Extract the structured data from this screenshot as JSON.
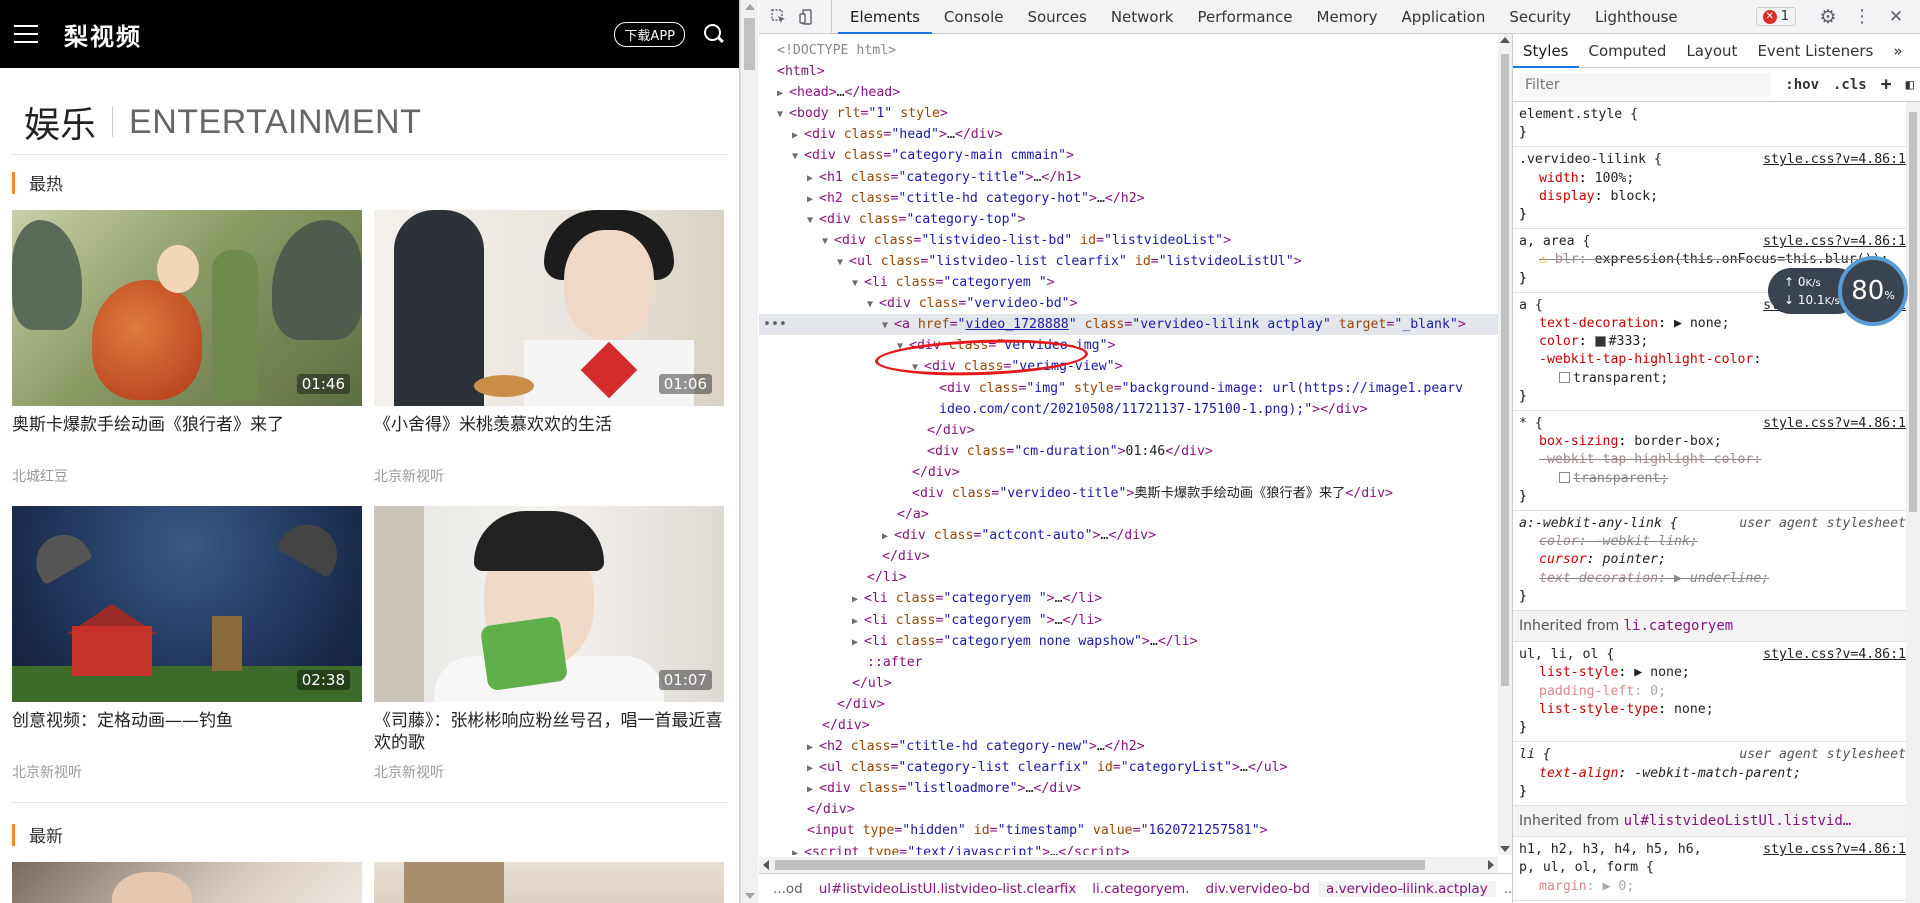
{
  "mobile": {
    "logo": "梨视频",
    "download_button": "下载APP",
    "category_cn": "娱乐",
    "category_en": "ENTERTAINMENT",
    "section_hot": "最热",
    "section_new": "最新",
    "videos": [
      {
        "title": "奥斯卡爆款手绘动画《狼行者》来了",
        "author": "北城红豆",
        "duration": "01:46"
      },
      {
        "title": "《小舍得》米桃羡慕欢欢的生活",
        "author": "北京新视听",
        "duration": "01:06"
      },
      {
        "title": "创意视频：定格动画——钓鱼",
        "author": "北京新视听",
        "duration": "02:38"
      },
      {
        "title": "《司藤》：张彬彬响应粉丝号召，唱一首最近喜欢的歌",
        "author": "北京新视听",
        "duration": "01:07"
      }
    ]
  },
  "devtools": {
    "tabs": [
      "Elements",
      "Console",
      "Sources",
      "Network",
      "Performance",
      "Memory",
      "Application",
      "Security",
      "Lighthouse"
    ],
    "active_tab": "Elements",
    "error_count": "1",
    "styles_tabs": [
      "Styles",
      "Computed",
      "Layout",
      "Event Listeners"
    ],
    "filter_placeholder": "Filter",
    "filter_hov": ":hov",
    "filter_cls": ".cls",
    "breadcrumbs": [
      "...od",
      "ul#listvideoListUl.listvideo-list.clearfix",
      "li.categoryem.",
      "div.vervideo-bd",
      "a.vervideo-lilink.actplay",
      "..."
    ],
    "speed_widget": {
      "upload": "0",
      "upload_unit": "K/s",
      "download": "10.1",
      "download_unit": "K/s",
      "percent": "80",
      "percent_unit": "%"
    }
  }
}
